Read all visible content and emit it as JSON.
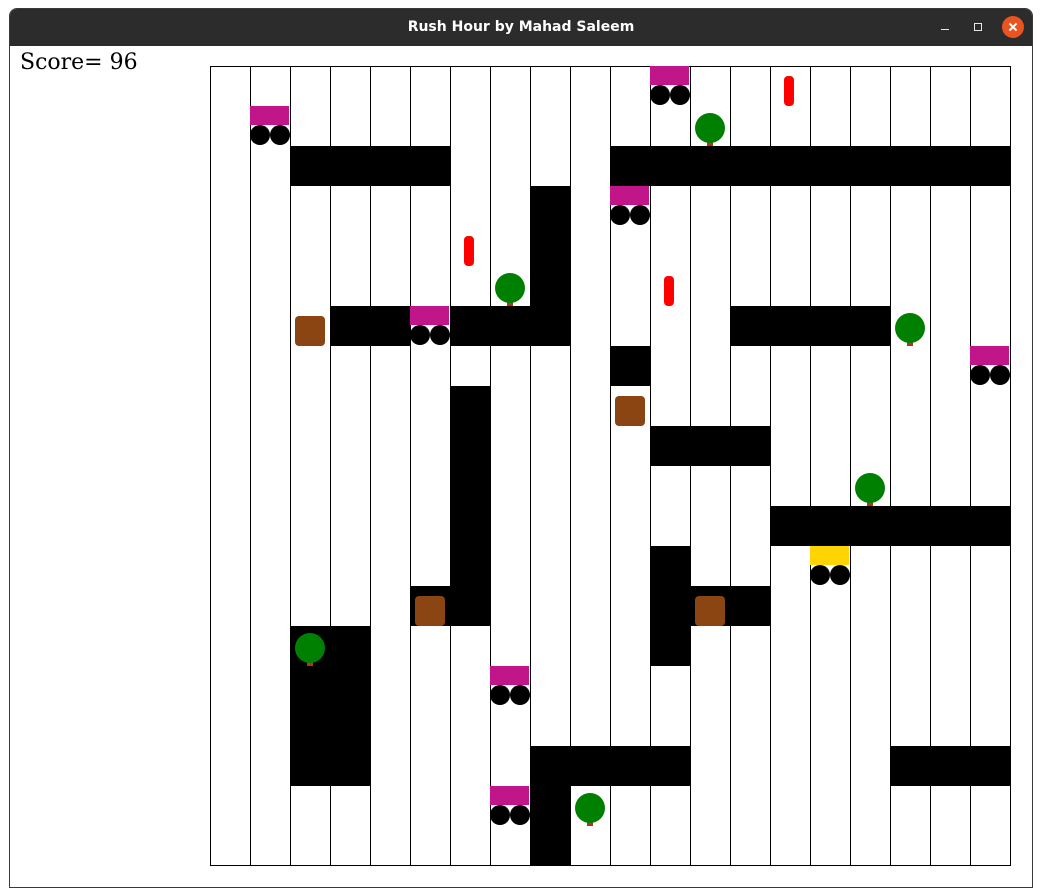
{
  "window": {
    "title": "Rush Hour by Mahad Saleem",
    "minimize_icon": "minimize-icon",
    "maximize_icon": "maximize-icon",
    "close_icon": "close-icon",
    "close_color": "#e95420"
  },
  "hud": {
    "score_label": "Score= 96"
  },
  "board": {
    "columns": 20,
    "rows": 20,
    "colors": {
      "background": "#ffffff",
      "grid_line": "#000000",
      "wall": "#000000",
      "enemy_car_body": "#c0168a",
      "player_car_body": "#ffd400",
      "wheel": "#000000",
      "tree_crown": "#008000",
      "tree_trunk": "#b5351a",
      "box": "#8b4513",
      "passenger": "#ff0000"
    },
    "walls": [
      {
        "col": 2,
        "row": 2,
        "w": 4,
        "h": 1
      },
      {
        "col": 10,
        "row": 2,
        "w": 10,
        "h": 1
      },
      {
        "col": 8,
        "row": 3,
        "w": 1,
        "h": 4
      },
      {
        "col": 3,
        "row": 6,
        "w": 2,
        "h": 1
      },
      {
        "col": 6,
        "row": 6,
        "w": 3,
        "h": 1
      },
      {
        "col": 13,
        "row": 6,
        "w": 4,
        "h": 1
      },
      {
        "col": 10,
        "row": 7,
        "w": 1,
        "h": 1
      },
      {
        "col": 6,
        "row": 8,
        "w": 1,
        "h": 6
      },
      {
        "col": 5,
        "row": 13,
        "w": 1,
        "h": 1
      },
      {
        "col": 11,
        "row": 9,
        "w": 3,
        "h": 1
      },
      {
        "col": 14,
        "row": 11,
        "w": 6,
        "h": 1
      },
      {
        "col": 11,
        "row": 12,
        "w": 1,
        "h": 3
      },
      {
        "col": 12,
        "row": 13,
        "w": 2,
        "h": 1
      },
      {
        "col": 2,
        "row": 14,
        "w": 2,
        "h": 4
      },
      {
        "col": 8,
        "row": 17,
        "w": 4,
        "h": 1
      },
      {
        "col": 8,
        "row": 18,
        "w": 1,
        "h": 2
      },
      {
        "col": 17,
        "row": 17,
        "w": 3,
        "h": 1
      }
    ],
    "enemy_cars": [
      {
        "col": 11,
        "row": 0
      },
      {
        "col": 1,
        "row": 1
      },
      {
        "col": 10,
        "row": 3
      },
      {
        "col": 5,
        "row": 6
      },
      {
        "col": 19,
        "row": 7
      },
      {
        "col": 7,
        "row": 15
      },
      {
        "col": 7,
        "row": 18
      }
    ],
    "player_car": {
      "col": 15,
      "row": 12
    },
    "trees": [
      {
        "col": 12,
        "row": 1
      },
      {
        "col": 7,
        "row": 5
      },
      {
        "col": 17,
        "row": 6
      },
      {
        "col": 16,
        "row": 10
      },
      {
        "col": 2,
        "row": 14
      },
      {
        "col": 9,
        "row": 18
      }
    ],
    "boxes": [
      {
        "col": 2,
        "row": 6
      },
      {
        "col": 10,
        "row": 8
      },
      {
        "col": 5,
        "row": 13
      },
      {
        "col": 12,
        "row": 13
      }
    ],
    "passengers": [
      {
        "col": 14,
        "row": 0
      },
      {
        "col": 6,
        "row": 4
      },
      {
        "col": 11,
        "row": 5
      }
    ]
  }
}
